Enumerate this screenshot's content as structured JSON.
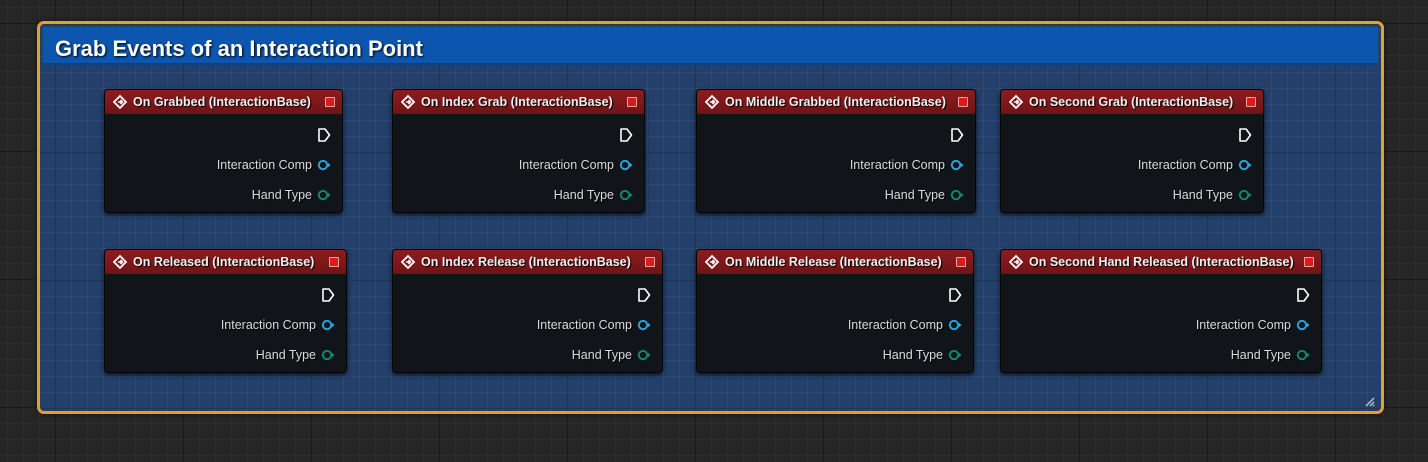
{
  "comment_box": {
    "title": "Grab Events of an Interaction Point",
    "header_color": "#0d56b0",
    "border_color": "#e0a034"
  },
  "pins": {
    "interaction_comp_color": "#2aa6e0",
    "hand_type_color": "#0e8b70"
  },
  "nodes": [
    {
      "title": "On Grabbed (InteractionBase)",
      "pins": [
        "Interaction Comp",
        "Hand Type"
      ]
    },
    {
      "title": "On Index Grab (InteractionBase)",
      "pins": [
        "Interaction Comp",
        "Hand Type"
      ]
    },
    {
      "title": "On Middle Grabbed (InteractionBase)",
      "pins": [
        "Interaction Comp",
        "Hand Type"
      ]
    },
    {
      "title": "On Second Grab (InteractionBase)",
      "pins": [
        "Interaction Comp",
        "Hand Type"
      ]
    },
    {
      "title": "On Released (InteractionBase)",
      "pins": [
        "Interaction Comp",
        "Hand Type"
      ]
    },
    {
      "title": "On Index Release (InteractionBase)",
      "pins": [
        "Interaction Comp",
        "Hand Type"
      ]
    },
    {
      "title": "On Middle Release (InteractionBase)",
      "pins": [
        "Interaction Comp",
        "Hand Type"
      ]
    },
    {
      "title": "On Second Hand Released (InteractionBase)",
      "pins": [
        "Interaction Comp",
        "Hand Type"
      ]
    }
  ]
}
